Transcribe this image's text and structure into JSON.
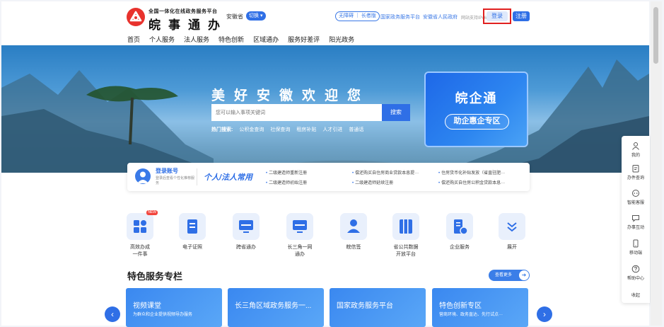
{
  "header": {
    "brand_sub": "全国一体化在线政务服务平台",
    "brand_main": "皖事通办",
    "region": "安徽省",
    "switch_label": "切换",
    "access_pill": "无障碍 ｜ 长者版",
    "links": [
      "国家政务服务平台",
      "安徽省人民政府"
    ],
    "ipv6": "网站支持IPv6",
    "login": "登录",
    "register": "注册"
  },
  "nav": [
    "首页",
    "个人服务",
    "法人服务",
    "特色创新",
    "区域通办",
    "服务好差评",
    "阳光政务"
  ],
  "banner": {
    "title": "美好安徽欢迎您",
    "search_placeholder": "您可以输入事项关键词",
    "search_button": "搜索",
    "hot_label": "热门搜索:",
    "hot_items": [
      "公积金查询",
      "社保查询",
      "租房补贴",
      "人才引进",
      "普通话"
    ],
    "biz_title": "皖企通",
    "biz_button": "助企惠企专区"
  },
  "strip": {
    "login_account": "登录账号",
    "login_desc": "登录后查看个性化推荐服务",
    "badge": "个人/法人常用",
    "news": [
      "二级建造师重新注册",
      "偿还购买自住房商业贷款本息提···",
      "住房货币化补贴发放（省直驻肥···",
      "二级建造师初始注册",
      "二级建造师延续注册",
      "偿还购买自住房公积金贷款本息···"
    ]
  },
  "services": [
    {
      "label": "高效办成\n一件事",
      "icon": "grid-icon",
      "badge": "NEW"
    },
    {
      "label": "电子证照",
      "icon": "document-icon"
    },
    {
      "label": "跨省通办",
      "icon": "monitor-icon"
    },
    {
      "label": "长三角一网\n通办",
      "icon": "monitor-icon"
    },
    {
      "label": "皖信签",
      "icon": "user-icon"
    },
    {
      "label": "省公共数据\n开放平台",
      "icon": "database-icon"
    },
    {
      "label": "企业服务",
      "icon": "enterprise-icon"
    },
    {
      "label": "展开",
      "icon": "chevron-down-icon"
    }
  ],
  "section": {
    "title": "特色服务专栏",
    "more": "查看更多"
  },
  "cards": [
    {
      "title": "视频课堂",
      "sub": "为群众和企业提供视频导办服务"
    },
    {
      "title": "长三角区域政务服务一...",
      "sub": ""
    },
    {
      "title": "国家政务服务平台",
      "sub": ""
    },
    {
      "title": "特色创新专区",
      "sub": "营商环境、政务直达、先行试点···"
    }
  ],
  "float": [
    "我的",
    "办件查询",
    "智能客服",
    "办事互动",
    "移动端",
    "帮助中心",
    "收起"
  ],
  "colors": {
    "primary": "#2f6fe6",
    "highlight_border": "#e02020"
  }
}
